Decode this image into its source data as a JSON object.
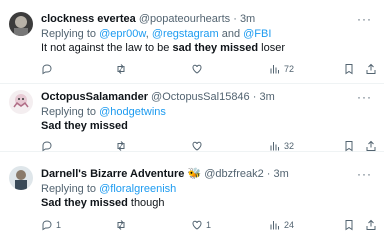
{
  "tweets": [
    {
      "name": "clockness evertea",
      "badge": "",
      "handle": "@popateourhearts",
      "time": "3m",
      "replying_prefix": "Replying to ",
      "mentions": [
        "@epr00w",
        "@regstagram",
        "@FBI"
      ],
      "mention_separators": [
        ", ",
        " and "
      ],
      "text_pre": "It not against the law to be ",
      "text_bold": "sad they missed",
      "text_post": " loser",
      "counts": {
        "reply": "",
        "retweet": "",
        "like": "",
        "views": "72"
      }
    },
    {
      "name": "OctopusSalamander",
      "badge": "",
      "handle": "@OctopusSal15846",
      "time": "3m",
      "replying_prefix": "Replying to ",
      "mentions": [
        "@hodgetwins"
      ],
      "mention_separators": [],
      "text_pre": "",
      "text_bold": "Sad they missed",
      "text_post": "",
      "counts": {
        "reply": "",
        "retweet": "",
        "like": "",
        "views": "32"
      }
    },
    {
      "name": "Darnell's Bizarre Adventure",
      "badge": "🐝",
      "handle": "@dbzfreak2",
      "time": "3m",
      "replying_prefix": "Replying to ",
      "mentions": [
        "@floralgreenish"
      ],
      "mention_separators": [],
      "text_pre": "",
      "text_bold": "Sad they missed",
      "text_post": " though",
      "counts": {
        "reply": "1",
        "retweet": "",
        "like": "1",
        "views": "24"
      }
    }
  ],
  "separator_dot": " · ",
  "more_glyph": "···",
  "colors": {
    "link": "#1d9bf0",
    "muted": "#536471",
    "text": "#0f1419",
    "divider": "#eff3f4"
  },
  "icons": [
    "more-icon",
    "reply-icon",
    "retweet-icon",
    "like-icon",
    "views-icon",
    "bookmark-icon",
    "share-icon"
  ]
}
